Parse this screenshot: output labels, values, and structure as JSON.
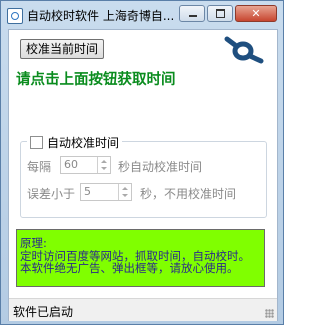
{
  "window": {
    "title": "自动校时软件 上海奇博自..."
  },
  "toolbar": {
    "sync_button_label": "校准当前时间",
    "logo_icon": "infinity-logo-icon"
  },
  "prompt": "请点击上面按钮获取时间",
  "auto": {
    "checkbox_label": "自动校准时间",
    "checked": false,
    "interval_prefix": "每隔",
    "interval_value": "60",
    "interval_suffix": "秒自动校准时间",
    "tolerance_prefix": "误差小于",
    "tolerance_value": "5",
    "tolerance_suffix": "秒，不用校准时间"
  },
  "info": {
    "line1": "原理:",
    "line2": "定时访问百度等网站，抓取时间，自动校时。",
    "line3": "本软件绝无广告、弹出框等，请放心使用。"
  },
  "status": {
    "text": "软件已启动"
  },
  "colors": {
    "prompt": "#0a8c1e",
    "info_bg": "#80ff00",
    "logo": "#1f4f7f"
  }
}
